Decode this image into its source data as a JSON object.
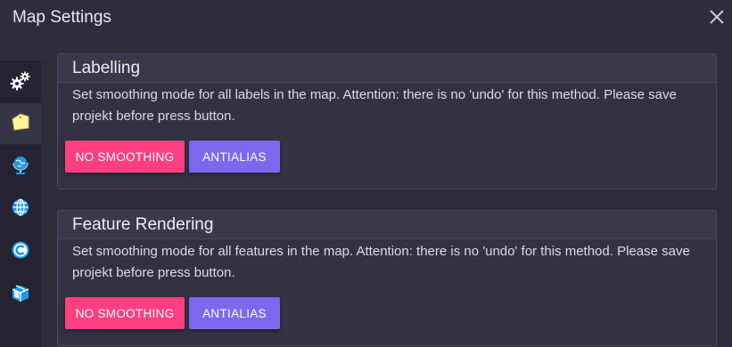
{
  "window": {
    "title": "Map Settings",
    "close_icon": "close-icon"
  },
  "sidebar": {
    "items": [
      {
        "id": "settings",
        "icon": "gears-icon",
        "active": false
      },
      {
        "id": "labels",
        "icon": "label-tag-icon",
        "active": true
      },
      {
        "id": "globe-stand",
        "icon": "globe-stand-icon",
        "active": false
      },
      {
        "id": "web",
        "icon": "globe-grid-icon",
        "active": false
      },
      {
        "id": "copyright",
        "icon": "copyright-icon",
        "active": false
      },
      {
        "id": "package",
        "icon": "box-icon",
        "active": false
      }
    ]
  },
  "panels": {
    "labelling": {
      "title": "Labelling",
      "text": "Set smoothing mode for all labels in the map. Attention: there is no 'undo' for this method. Please save projekt before press button.",
      "no_smoothing_label": "NO SMOOTHING",
      "antialias_label": "ANTIALIAS"
    },
    "feature_rendering": {
      "title": "Feature Rendering",
      "text": "Set smoothing mode for all features in the map. Attention: there is no 'undo' for this method. Please save projekt before press button.",
      "no_smoothing_label": "NO SMOOTHING",
      "antialias_label": "ANTIALIAS"
    }
  },
  "colors": {
    "background": "#2f2d3c",
    "sidebar": "#262433",
    "pink_button": "#ff3f7f",
    "purple_button": "#7b68ee",
    "icon_blue": "#2196f3",
    "icon_yellow": "#fff59d"
  }
}
